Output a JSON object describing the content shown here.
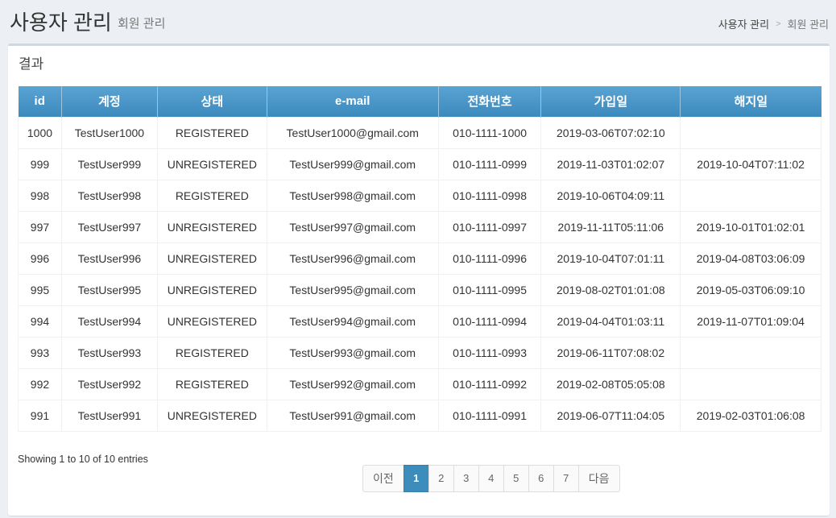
{
  "header": {
    "title": "사용자 관리",
    "subtitle": "회원 관리",
    "breadcrumb": [
      "사용자 관리",
      ">",
      "회원 관리"
    ]
  },
  "box": {
    "title": "결과"
  },
  "table": {
    "columns": [
      "id",
      "계정",
      "상태",
      "e-mail",
      "전화번호",
      "가입일",
      "해지일"
    ],
    "rows": [
      [
        "1000",
        "TestUser1000",
        "REGISTERED",
        "TestUser1000@gmail.com",
        "010-1111-1000",
        "2019-03-06T07:02:10",
        ""
      ],
      [
        "999",
        "TestUser999",
        "UNREGISTERED",
        "TestUser999@gmail.com",
        "010-1111-0999",
        "2019-11-03T01:02:07",
        "2019-10-04T07:11:02"
      ],
      [
        "998",
        "TestUser998",
        "REGISTERED",
        "TestUser998@gmail.com",
        "010-1111-0998",
        "2019-10-06T04:09:11",
        ""
      ],
      [
        "997",
        "TestUser997",
        "UNREGISTERED",
        "TestUser997@gmail.com",
        "010-1111-0997",
        "2019-11-11T05:11:06",
        "2019-10-01T01:02:01"
      ],
      [
        "996",
        "TestUser996",
        "UNREGISTERED",
        "TestUser996@gmail.com",
        "010-1111-0996",
        "2019-10-04T07:01:11",
        "2019-04-08T03:06:09"
      ],
      [
        "995",
        "TestUser995",
        "UNREGISTERED",
        "TestUser995@gmail.com",
        "010-1111-0995",
        "2019-08-02T01:01:08",
        "2019-05-03T06:09:10"
      ],
      [
        "994",
        "TestUser994",
        "UNREGISTERED",
        "TestUser994@gmail.com",
        "010-1111-0994",
        "2019-04-04T01:03:11",
        "2019-11-07T01:09:04"
      ],
      [
        "993",
        "TestUser993",
        "REGISTERED",
        "TestUser993@gmail.com",
        "010-1111-0993",
        "2019-06-11T07:08:02",
        ""
      ],
      [
        "992",
        "TestUser992",
        "REGISTERED",
        "TestUser992@gmail.com",
        "010-1111-0992",
        "2019-02-08T05:05:08",
        ""
      ],
      [
        "991",
        "TestUser991",
        "UNREGISTERED",
        "TestUser991@gmail.com",
        "010-1111-0991",
        "2019-06-07T11:04:05",
        "2019-02-03T01:06:08"
      ]
    ]
  },
  "info": "Showing 1 to 10 of 10 entries",
  "pagination": {
    "prev": "이전",
    "pages": [
      "1",
      "2",
      "3",
      "4",
      "5",
      "6",
      "7"
    ],
    "active": "1",
    "next": "다음"
  },
  "colors": {
    "header_bg": "#3c89bd",
    "active_page": "#3c8dbc",
    "page_bg": "#ecf0f5"
  }
}
